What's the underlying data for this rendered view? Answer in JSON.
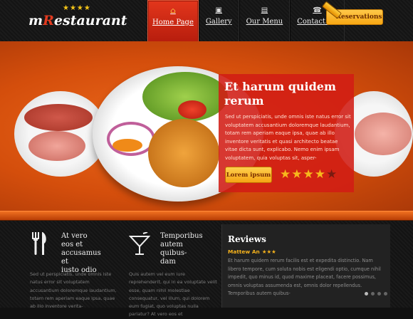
{
  "brand": {
    "logo_prefix": "m",
    "logo_r": "R",
    "logo_rest": "estaurant",
    "stars": "★★★★"
  },
  "nav": {
    "items": [
      {
        "label": "Home Page",
        "icon": "⌂",
        "icon_name": "home-icon",
        "active": true
      },
      {
        "label": "Gallery",
        "icon": "▣",
        "icon_name": "picture-icon"
      },
      {
        "label": "Our Menu",
        "icon": "▤",
        "icon_name": "book-icon"
      },
      {
        "label": "Contact Us",
        "icon": "☎",
        "icon_name": "phone-icon"
      }
    ],
    "reservations_label": "Reservations"
  },
  "hero": {
    "title": "Et harum quidem rerum",
    "text": "Sed ut perspiciatis, unde omnis iste natus error sit voluptatem accusantium doloremque laudantium, totam rem aperiam eaque ipsa, quae ab illo inventore veritatis et quasi architecto beatae vitae dicta sunt, explicabo. Nemo enim ipsam voluptatem, quia voluptas sit, asper-",
    "button_label": "Lorem ipsum",
    "rating": 4,
    "rating_max": 5
  },
  "features": [
    {
      "icon_name": "cutlery-icon",
      "icon": "🍴",
      "title_l1": "At vero eos et",
      "title_l2": "accusamus et",
      "title_l3": "iusto odio",
      "text": "Sed ut perspiciatis, unde omnis iste natus error sit voluptatem accusantium doloremque laudantium, totam rem aperiam eaque ipsa, quae ab illo inventore verita-"
    },
    {
      "icon_name": "cocktail-icon",
      "icon": "🍸",
      "title_l1": "Temporibus",
      "title_l2": "autem quibus-",
      "title_l3": "dam",
      "text": "Quis autem vel eum iure reprehenderit, qui in ea voluptate velit esse, quam nihil molestiae consequatur, vel illum, qui dolorem eum fugiat, quo voluptas nulla pariatur? At vero eos et"
    }
  ],
  "reviews": {
    "title": "Reviews",
    "author": "Mattew An",
    "stars": "★★★",
    "text": "Et harum quidem rerum facilis est et expedita distinctio. Nam libero tempore, cum soluta nobis est eligendi optio, cumque nihil impedit, quo minus id, quod maxime placeat, facere possimus, omnis voluptas assumenda est, omnis dolor repellendus. Temporibus autem quibus-"
  },
  "colors": {
    "accent": "#e2361c",
    "gold": "#f7a713",
    "hero_orange": "#d44e0c"
  }
}
